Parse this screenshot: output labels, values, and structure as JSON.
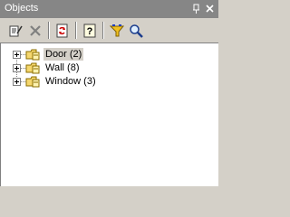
{
  "window": {
    "title": "Objects",
    "pin_glyph": "⊥",
    "close_glyph": "✕"
  },
  "toolbar": {
    "tools": [
      {
        "name": "properties-icon"
      },
      {
        "name": "delete-icon"
      },
      {
        "name": "refresh-icon"
      },
      {
        "name": "help-icon"
      },
      {
        "name": "filter-icon"
      },
      {
        "name": "search-icon"
      }
    ]
  },
  "tree": {
    "items": [
      {
        "label": "Door (2)",
        "selected": true
      },
      {
        "label": "Wall (8)",
        "selected": false
      },
      {
        "label": "Window (3)",
        "selected": false
      }
    ]
  },
  "colors": {
    "titlebar": "#868686",
    "panel": "#d4d0c8",
    "tree_bg": "#ffffff",
    "selection": "#d4d0c8"
  }
}
